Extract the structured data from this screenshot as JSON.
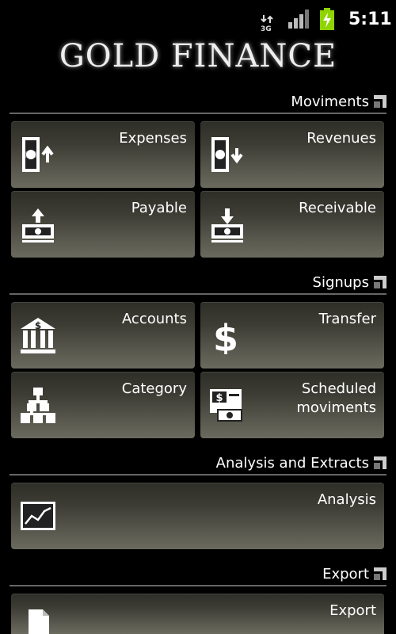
{
  "status_bar": {
    "network": "3G",
    "time": "5:11"
  },
  "app": {
    "title": "GOLD FINANCE"
  },
  "sections": {
    "moviments": {
      "title": "Moviments",
      "expenses": "Expenses",
      "revenues": "Revenues",
      "payable": "Payable",
      "receivable": "Receivable"
    },
    "signups": {
      "title": "Signups",
      "accounts": "Accounts",
      "transfer": "Transfer",
      "category": "Category",
      "scheduled_line1": "Scheduled",
      "scheduled_line2": "moviments"
    },
    "analysis": {
      "title": "Analysis and Extracts",
      "analysis": "Analysis"
    },
    "export": {
      "title": "Export",
      "export": "Export"
    }
  },
  "colors": {
    "background": "#000000",
    "tile_dark": "#2e2e28",
    "tile_light": "#6a6a5e",
    "divider": "#666666",
    "battery": "#8fd400"
  },
  "icons": [
    "network-3g-icon",
    "signal-icon",
    "battery-charging-icon",
    "expand-corner-icon",
    "money-up-icon",
    "money-down-icon",
    "cash-out-icon",
    "cash-in-icon",
    "bank-icon",
    "dollar-icon",
    "hierarchy-icon",
    "schedule-money-icon",
    "chart-icon",
    "document-icon"
  ]
}
